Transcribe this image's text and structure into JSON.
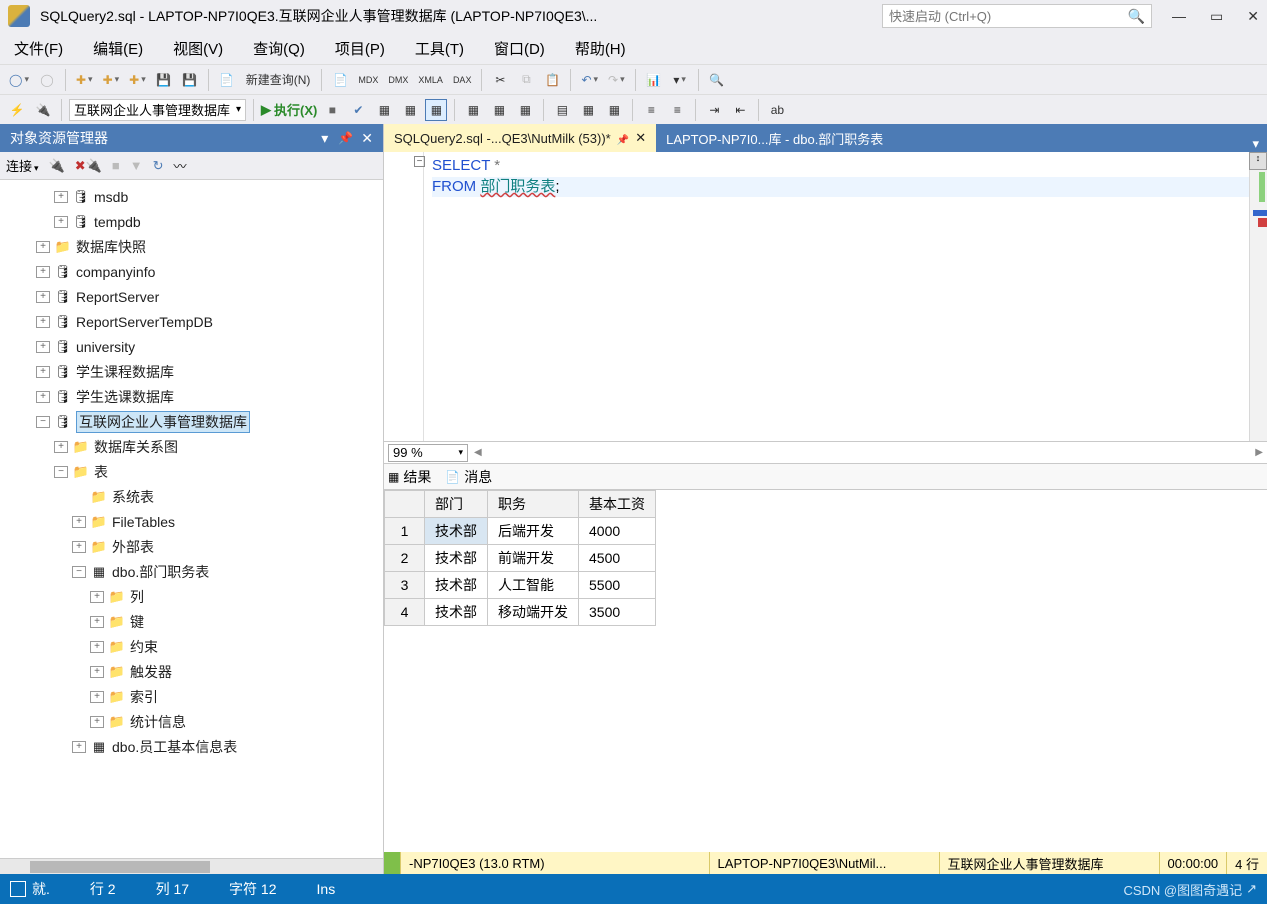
{
  "title": "SQLQuery2.sql - LAPTOP-NP7I0QE3.互联网企业人事管理数据库 (LAPTOP-NP7I0QE3\\...",
  "quickLaunch": {
    "placeholder": "快速启动 (Ctrl+Q)"
  },
  "menu": {
    "file": "文件(F)",
    "edit": "编辑(E)",
    "view": "视图(V)",
    "query": "查询(Q)",
    "project": "项目(P)",
    "tools": "工具(T)",
    "window": "窗口(D)",
    "help": "帮助(H)"
  },
  "toolbar1": {
    "newQuery": "新建查询(N)"
  },
  "toolbar2": {
    "db": "互联网企业人事管理数据库",
    "execute": "执行(X)"
  },
  "oe": {
    "title": "对象资源管理器",
    "connect": "连接",
    "tree": [
      {
        "indent": 3,
        "exp": "+",
        "ico": "🛢",
        "txt": "msdb"
      },
      {
        "indent": 3,
        "exp": "+",
        "ico": "🛢",
        "txt": "tempdb"
      },
      {
        "indent": 2,
        "exp": "+",
        "ico": "📁",
        "txt": "数据库快照"
      },
      {
        "indent": 2,
        "exp": "+",
        "ico": "🛢",
        "txt": "companyinfo"
      },
      {
        "indent": 2,
        "exp": "+",
        "ico": "🛢",
        "txt": "ReportServer"
      },
      {
        "indent": 2,
        "exp": "+",
        "ico": "🛢",
        "txt": "ReportServerTempDB"
      },
      {
        "indent": 2,
        "exp": "+",
        "ico": "🛢",
        "txt": "university"
      },
      {
        "indent": 2,
        "exp": "+",
        "ico": "🛢",
        "txt": "学生课程数据库"
      },
      {
        "indent": 2,
        "exp": "+",
        "ico": "🛢",
        "txt": "学生选课数据库"
      },
      {
        "indent": 2,
        "exp": "−",
        "ico": "🛢",
        "txt": "互联网企业人事管理数据库",
        "sel": true
      },
      {
        "indent": 3,
        "exp": "+",
        "ico": "📁",
        "txt": "数据库关系图"
      },
      {
        "indent": 3,
        "exp": "−",
        "ico": "📁",
        "txt": "表"
      },
      {
        "indent": 4,
        "exp": "",
        "ico": "📁",
        "txt": "系统表"
      },
      {
        "indent": 4,
        "exp": "+",
        "ico": "📁",
        "txt": "FileTables"
      },
      {
        "indent": 4,
        "exp": "+",
        "ico": "📁",
        "txt": "外部表"
      },
      {
        "indent": 4,
        "exp": "−",
        "ico": "▦",
        "txt": "dbo.部门职务表"
      },
      {
        "indent": 5,
        "exp": "+",
        "ico": "📁",
        "txt": "列"
      },
      {
        "indent": 5,
        "exp": "+",
        "ico": "📁",
        "txt": "键"
      },
      {
        "indent": 5,
        "exp": "+",
        "ico": "📁",
        "txt": "约束"
      },
      {
        "indent": 5,
        "exp": "+",
        "ico": "📁",
        "txt": "触发器"
      },
      {
        "indent": 5,
        "exp": "+",
        "ico": "📁",
        "txt": "索引"
      },
      {
        "indent": 5,
        "exp": "+",
        "ico": "📁",
        "txt": "统计信息"
      },
      {
        "indent": 4,
        "exp": "+",
        "ico": "▦",
        "txt": "dbo.员工基本信息表"
      }
    ]
  },
  "docTabs": {
    "active": "SQLQuery2.sql -...QE3\\NutMilk (53))*",
    "inactive": "LAPTOP-NP7I0...库 - dbo.部门职务表"
  },
  "code": {
    "line1a": "SELECT",
    "line1b": "*",
    "line2a": "FROM",
    "line2b": "部门职务表",
    "line2c": ";"
  },
  "zoom": "99 %",
  "resTabs": {
    "results": "结果",
    "messages": "消息"
  },
  "grid": {
    "headers": [
      "部门",
      "职务",
      "基本工资"
    ],
    "rows": [
      {
        "n": "1",
        "c1": "技术部",
        "c2": "后端开发",
        "c3": "4000"
      },
      {
        "n": "2",
        "c1": "技术部",
        "c2": "前端开发",
        "c3": "4500"
      },
      {
        "n": "3",
        "c1": "技术部",
        "c2": "人工智能",
        "c3": "5500"
      },
      {
        "n": "4",
        "c1": "技术部",
        "c2": "移动端开发",
        "c3": "3500"
      }
    ]
  },
  "statusYellow": {
    "server": "-NP7I0QE3 (13.0 RTM)",
    "login": "LAPTOP-NP7I0QE3\\NutMil...",
    "db": "互联网企业人事管理数据库",
    "time": "00:00:00",
    "rows": "4 行"
  },
  "statusBlue": {
    "ready": "就.",
    "line": "行 2",
    "col": "列 17",
    "char": "字符 12",
    "ins": "Ins",
    "watermark": "CSDN @图图奇遇记"
  }
}
